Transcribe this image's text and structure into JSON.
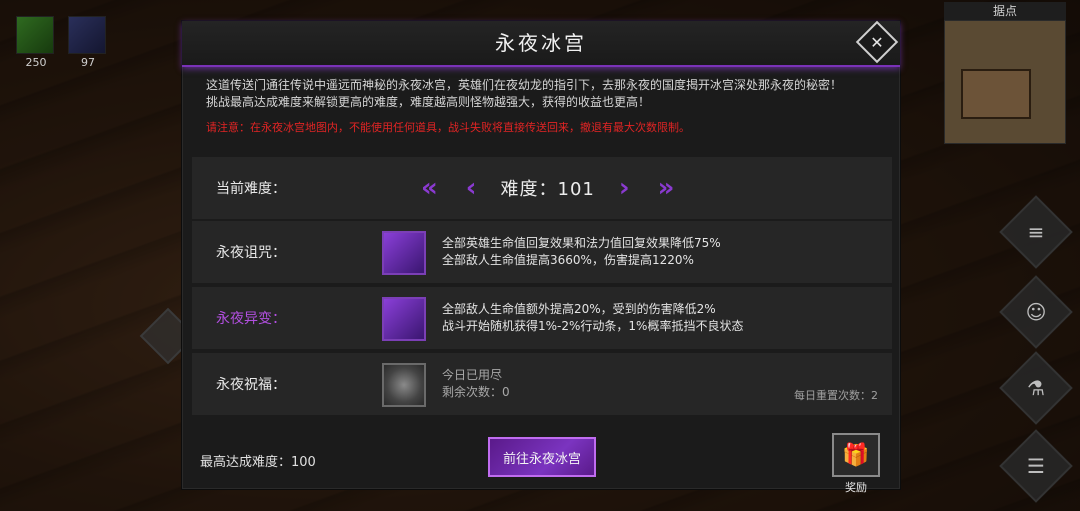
{
  "resources": [
    {
      "icon": "green-feather-icon",
      "value": "250"
    },
    {
      "icon": "blue-orb-icon",
      "value": "97"
    }
  ],
  "minimap": {
    "title": "据点"
  },
  "dialog": {
    "title": "永夜冰宫",
    "close_icon": "close-icon",
    "description_line1": "这道传送门通往传说中遥远而神秘的永夜冰宫，英雄们在夜幼龙的指引下，去那永夜的国度揭开冰宫深处那永夜的秘密！",
    "description_line2": "挑战最高达成难度来解锁更高的难度，难度越高则怪物越强大，获得的收益也更高！",
    "warning": "请注意：在永夜冰宫地图内，不能使用任何道具，战斗失败将直接传送回来，撤退有最大次数限制。",
    "difficulty": {
      "label": "当前难度：",
      "text": "难度：101"
    },
    "curse": {
      "label": "永夜诅咒：",
      "line1": "全部英雄生命值回复效果和法力值回复效果降低75%",
      "line2": "全部敌人生命值提高3660%，伤害提高1220%"
    },
    "mutation": {
      "label": "永夜异变：",
      "line1": "全部敌人生命值额外提高20%，受到的伤害降低2%",
      "line2": "战斗开始随机获得1%-2%行动条，1%概率抵挡不良状态"
    },
    "blessing": {
      "label": "永夜祝福：",
      "line1": "今日已用尽",
      "line2": "剩余次数：0",
      "reset": "每日重置次数：2"
    },
    "best": "最高达成难度：100",
    "go_button": "前往永夜冰宫",
    "reward_label": "奖励"
  },
  "colors": {
    "accent": "#7a32b8",
    "warning": "#e02424",
    "mutation_label": "#b24fe0"
  }
}
